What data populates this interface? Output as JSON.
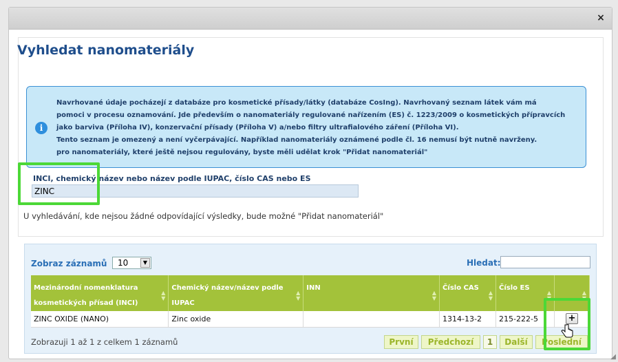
{
  "dialog": {
    "close_label": "×",
    "title": "Vyhledat nanomateriály"
  },
  "info": {
    "lines": [
      "Navrhované údaje pocházejí z databáze pro kosmetické přísady/látky (databáze CosIng). Navrhovaný seznam látek vám má",
      "pomoci v procesu oznamování. Jde především o nanomateriály regulované nařízením (ES) č. 1223/2009 o kosmetických přípravcích",
      "jako barviva (Příloha IV), konzervační přísady (Příloha V) a/nebo filtry ultrafialového záření (Příloha VI).",
      "Tento seznam je omezený a není vyčerpávající. Například nanomateriály oznámené podle čl. 16 nemusí být nutně navrženy.",
      "pro nanomateriály, které ještě nejsou regulovány, byste měli udělat krok \"Přidat nanomateriál\""
    ]
  },
  "search": {
    "label": "INCI, chemický název nebo název podle IUPAC, číslo CAS nebo ES",
    "value": "ZINC",
    "note": "U vyhledávání, kde nejsou žádné odpovídající výsledky, bude možné \"Přidat nanomateriál\""
  },
  "table": {
    "records_label": "Zobraz záznamů",
    "records_value": "10",
    "find_label": "Hledat:",
    "columns": [
      "Mezinárodní nomenklatura kosmetických přísad (INCI)",
      "Chemický název/název podle IUPAC",
      "INN",
      "Číslo CAS",
      "Číslo ES",
      ""
    ],
    "rows": [
      {
        "inci": "ZINC OXIDE (NANO)",
        "chemical": "Zinc oxide",
        "inn": "",
        "cas": "1314-13-2",
        "es": "215-222-5",
        "action": "+"
      }
    ],
    "footer": "Zobrazuji 1 až 1 z celkem 1 záznamů",
    "pager": {
      "first": "První",
      "prev": "Předchozí",
      "page": "1",
      "next": "Další",
      "last": "Poslední"
    }
  },
  "colors": {
    "title": "#1f4e8c",
    "info_bg": "#c8e8f8",
    "header_green": "#a3c23a",
    "highlight": "#4cd837"
  }
}
